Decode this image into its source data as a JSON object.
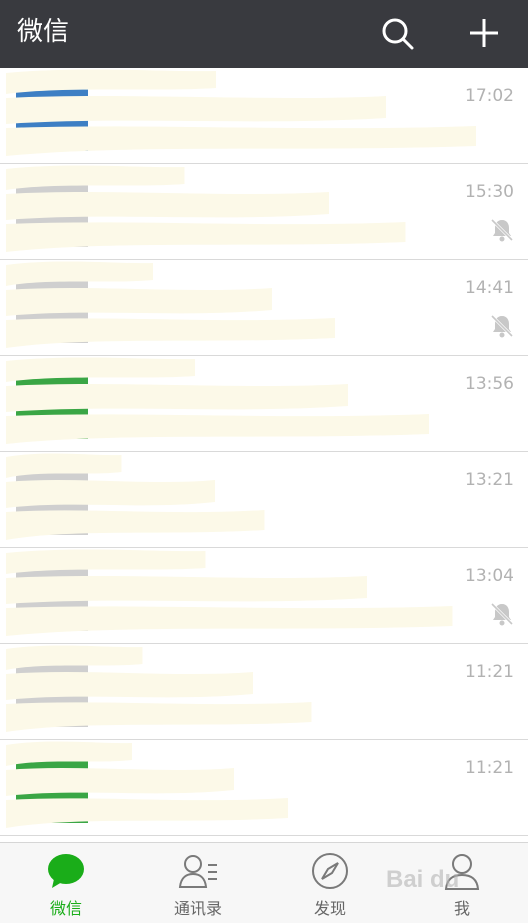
{
  "header": {
    "title": "微信"
  },
  "chats": [
    {
      "time": "17:02",
      "muted": false,
      "avatar": "blue"
    },
    {
      "time": "15:30",
      "muted": true,
      "avatar": "gray"
    },
    {
      "time": "14:41",
      "muted": true,
      "avatar": "gray"
    },
    {
      "time": "13:56",
      "muted": false,
      "avatar": "green"
    },
    {
      "time": "13:21",
      "muted": false,
      "avatar": "gray"
    },
    {
      "time": "13:04",
      "muted": true,
      "avatar": "gray"
    },
    {
      "time": "11:21",
      "muted": false,
      "avatar": "gray"
    },
    {
      "time": "11:21",
      "muted": false,
      "avatar": "green"
    }
  ],
  "tabs": [
    {
      "label": "微信",
      "icon": "chat-bubble-icon",
      "active": true
    },
    {
      "label": "通讯录",
      "icon": "contacts-icon",
      "active": false
    },
    {
      "label": "发现",
      "icon": "compass-icon",
      "active": false
    },
    {
      "label": "我",
      "icon": "person-icon",
      "active": false
    }
  ],
  "watermark": "Bai du",
  "colors": {
    "header": "#393a3f",
    "active": "#1aad19",
    "time": "#b2b2b2",
    "redaction": "#fcf9e8"
  }
}
